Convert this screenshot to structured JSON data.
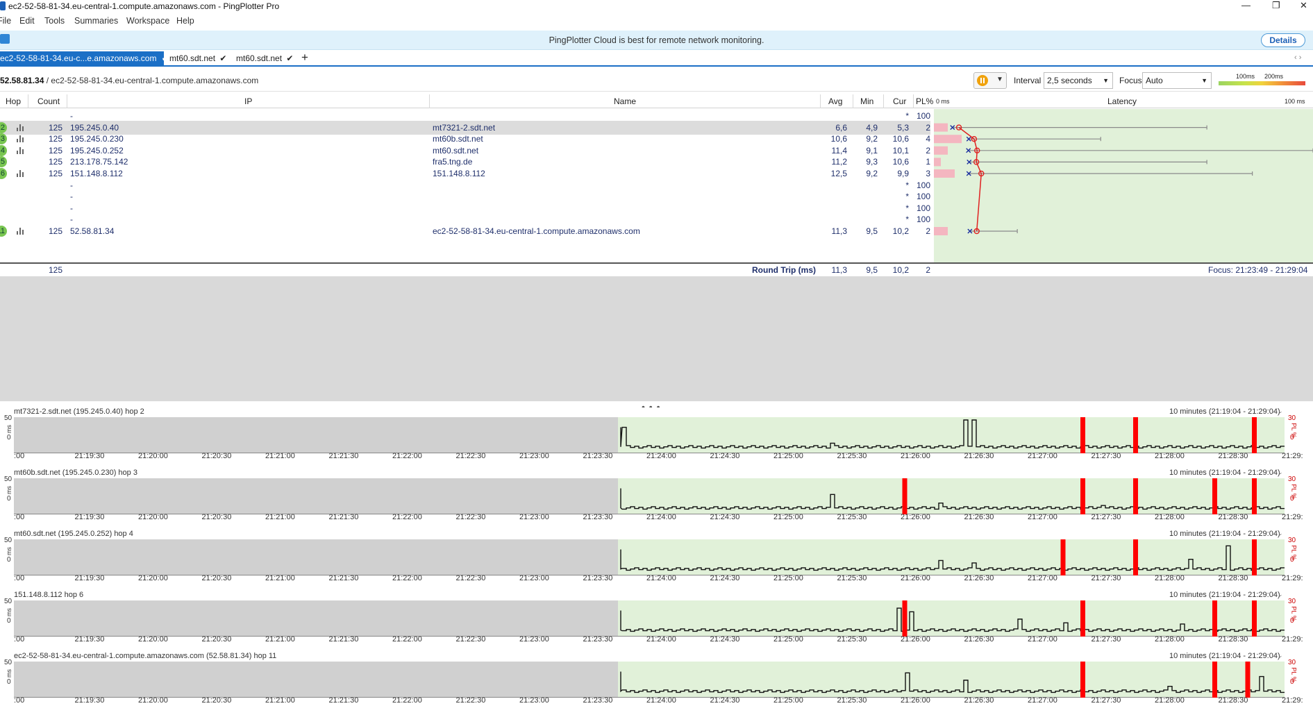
{
  "window": {
    "title": "ec2-52-58-81-34.eu-central-1.compute.amazonaws.com - PingPlotter Pro",
    "minimize": "—",
    "restore": "❐",
    "close": "✕"
  },
  "menu": [
    "File",
    "Edit",
    "Tools",
    "Summaries",
    "Workspace",
    "Help"
  ],
  "banner": {
    "message": "PingPlotter Cloud is best for remote network monitoring.",
    "details_label": "Details"
  },
  "tabs": [
    {
      "label": "ec2-52-58-81-34.eu-c...e.amazonaws.com",
      "active": true
    },
    {
      "label": "mt60.sdt.net",
      "active": false
    },
    {
      "label": "mt60.sdt.net",
      "active": false
    }
  ],
  "tabs_add": "+",
  "tabs_scroll": "‹  ›",
  "toolbar": {
    "target_ip": "52.58.81.34",
    "target_sep": " / ",
    "target_name": "ec2-52-58-81-34.eu-central-1.compute.amazonaws.com",
    "interval_label": "Interval",
    "interval_value": "2,5 seconds",
    "focus_label": "Focus",
    "focus_value": "Auto",
    "scale_100": "100ms",
    "scale_200": "200ms"
  },
  "columns": {
    "hop": "Hop",
    "count": "Count",
    "ip": "IP",
    "name": "Name",
    "avg": "Avg",
    "min": "Min",
    "cur": "Cur",
    "pl": "PL%",
    "lat_min": "0 ms",
    "latency": "Latency",
    "lat_max": "100 ms"
  },
  "hops": [
    {
      "hop": "",
      "count": "",
      "ip": "-",
      "name": "",
      "avg": "",
      "min": "",
      "cur": "*",
      "pl": "100",
      "graph": false,
      "avg_ms": null,
      "min_ms": null,
      "max_ms": null,
      "pl_pct": 100
    },
    {
      "hop": "2",
      "count": "125",
      "ip": "195.245.0.40",
      "name": "mt7321-2.sdt.net",
      "avg": "6,6",
      "min": "4,9",
      "cur": "5,3",
      "pl": "2",
      "graph": true,
      "avg_ms": 6.6,
      "min_ms": 4.9,
      "max_ms": 72,
      "pl_pct": 2
    },
    {
      "hop": "3",
      "count": "125",
      "ip": "195.245.0.230",
      "name": "mt60b.sdt.net",
      "avg": "10,6",
      "min": "9,2",
      "cur": "10,6",
      "pl": "4",
      "graph": true,
      "avg_ms": 10.6,
      "min_ms": 9.2,
      "max_ms": 44,
      "pl_pct": 4
    },
    {
      "hop": "4",
      "count": "125",
      "ip": "195.245.0.252",
      "name": "mt60.sdt.net",
      "avg": "11,4",
      "min": "9,1",
      "cur": "10,1",
      "pl": "2",
      "graph": true,
      "avg_ms": 11.4,
      "min_ms": 9.1,
      "max_ms": 100,
      "pl_pct": 2
    },
    {
      "hop": "5",
      "count": "125",
      "ip": "213.178.75.142",
      "name": "fra5.tng.de",
      "avg": "11,2",
      "min": "9,3",
      "cur": "10,6",
      "pl": "1",
      "graph": false,
      "avg_ms": 11.2,
      "min_ms": 9.3,
      "max_ms": 72,
      "pl_pct": 1
    },
    {
      "hop": "6",
      "count": "125",
      "ip": "151.148.8.112",
      "name": "151.148.8.112",
      "avg": "12,5",
      "min": "9,2",
      "cur": "9,9",
      "pl": "3",
      "graph": true,
      "avg_ms": 12.5,
      "min_ms": 9.2,
      "max_ms": 84,
      "pl_pct": 3
    },
    {
      "hop": "",
      "count": "",
      "ip": "-",
      "name": "",
      "avg": "",
      "min": "",
      "cur": "*",
      "pl": "100",
      "graph": false,
      "avg_ms": null,
      "min_ms": null,
      "max_ms": null,
      "pl_pct": 100
    },
    {
      "hop": "",
      "count": "",
      "ip": "-",
      "name": "",
      "avg": "",
      "min": "",
      "cur": "*",
      "pl": "100",
      "graph": false,
      "avg_ms": null,
      "min_ms": null,
      "max_ms": null,
      "pl_pct": 100
    },
    {
      "hop": "",
      "count": "",
      "ip": "-",
      "name": "",
      "avg": "",
      "min": "",
      "cur": "*",
      "pl": "100",
      "graph": false,
      "avg_ms": null,
      "min_ms": null,
      "max_ms": null,
      "pl_pct": 100
    },
    {
      "hop": "",
      "count": "",
      "ip": "-",
      "name": "",
      "avg": "",
      "min": "",
      "cur": "*",
      "pl": "100",
      "graph": false,
      "avg_ms": null,
      "min_ms": null,
      "max_ms": null,
      "pl_pct": 100
    },
    {
      "hop": "11",
      "count": "125",
      "ip": "52.58.81.34",
      "name": "ec2-52-58-81-34.eu-central-1.compute.amazonaws.com",
      "avg": "11,3",
      "min": "9,5",
      "cur": "10,2",
      "pl": "2",
      "graph": true,
      "avg_ms": 11.3,
      "min_ms": 9.5,
      "max_ms": 22,
      "pl_pct": 2
    }
  ],
  "round_trip": {
    "count": "125",
    "label": "Round Trip (ms)",
    "avg": "11,3",
    "min": "9,5",
    "cur": "10,2",
    "pl": "2",
    "focus": "Focus: 21:23:49 - 21:29:04"
  },
  "splitter": "• • •",
  "timelines": {
    "range": "10 minutes (21:19:04 - 21:29:04)",
    "y_max": "50",
    "y_min": "0",
    "y_unit": "ms",
    "pl_max": "30",
    "pl_unit": "PL %",
    "pl_min": "0",
    "x_ticks": [
      ":00",
      "21:19:30",
      "21:20:00",
      "21:20:30",
      "21:21:00",
      "21:21:30",
      "21:22:00",
      "21:22:30",
      "21:23:00",
      "21:23:30",
      "21:24:00",
      "21:24:30",
      "21:25:00",
      "21:25:30",
      "21:26:00",
      "21:26:30",
      "21:27:00",
      "21:27:30",
      "21:28:00",
      "21:28:30",
      "21:29:"
    ],
    "graphs": [
      {
        "title": "mt7321-2.sdt.net (195.245.0.40) hop 2",
        "spikes": [
          [
            0.0,
            38
          ],
          [
            0.32,
            12
          ],
          [
            0.52,
            50
          ],
          [
            0.53,
            50
          ]
        ],
        "losses": [
          0.7,
          0.78,
          0.96
        ]
      },
      {
        "title": "mt60b.sdt.net (195.245.0.230) hop 3",
        "spikes": [
          [
            0.32,
            28
          ],
          [
            0.48,
            14
          ],
          [
            0.73,
            10
          ]
        ],
        "losses": [
          0.43,
          0.7,
          0.78,
          0.9,
          0.96
        ]
      },
      {
        "title": "mt60.sdt.net (195.245.0.252) hop 4",
        "spikes": [
          [
            0.48,
            20
          ],
          [
            0.53,
            16
          ],
          [
            0.86,
            22
          ],
          [
            0.92,
            44
          ]
        ],
        "losses": [
          0.67,
          0.78,
          0.96
        ]
      },
      {
        "title": "151.148.8.112 hop 6",
        "spikes": [
          [
            0.42,
            42
          ],
          [
            0.44,
            36
          ],
          [
            0.6,
            24
          ],
          [
            0.67,
            18
          ],
          [
            0.85,
            16
          ]
        ],
        "losses": [
          0.43,
          0.7,
          0.9,
          0.96
        ]
      },
      {
        "title": "ec2-52-58-81-34.eu-central-1.compute.amazonaws.com (52.58.81.34) hop 11",
        "spikes": [
          [
            0.43,
            36
          ],
          [
            0.52,
            24
          ],
          [
            0.83,
            14
          ],
          [
            0.97,
            30
          ]
        ],
        "losses": [
          0.7,
          0.9,
          0.95
        ]
      }
    ]
  },
  "colors": {
    "accent": "#1b6fc6",
    "hop_ok": "#79c651",
    "latency_bg": "#e1f1d9",
    "loss": "#ff0000",
    "pl_bar": "#f4b6c0"
  }
}
